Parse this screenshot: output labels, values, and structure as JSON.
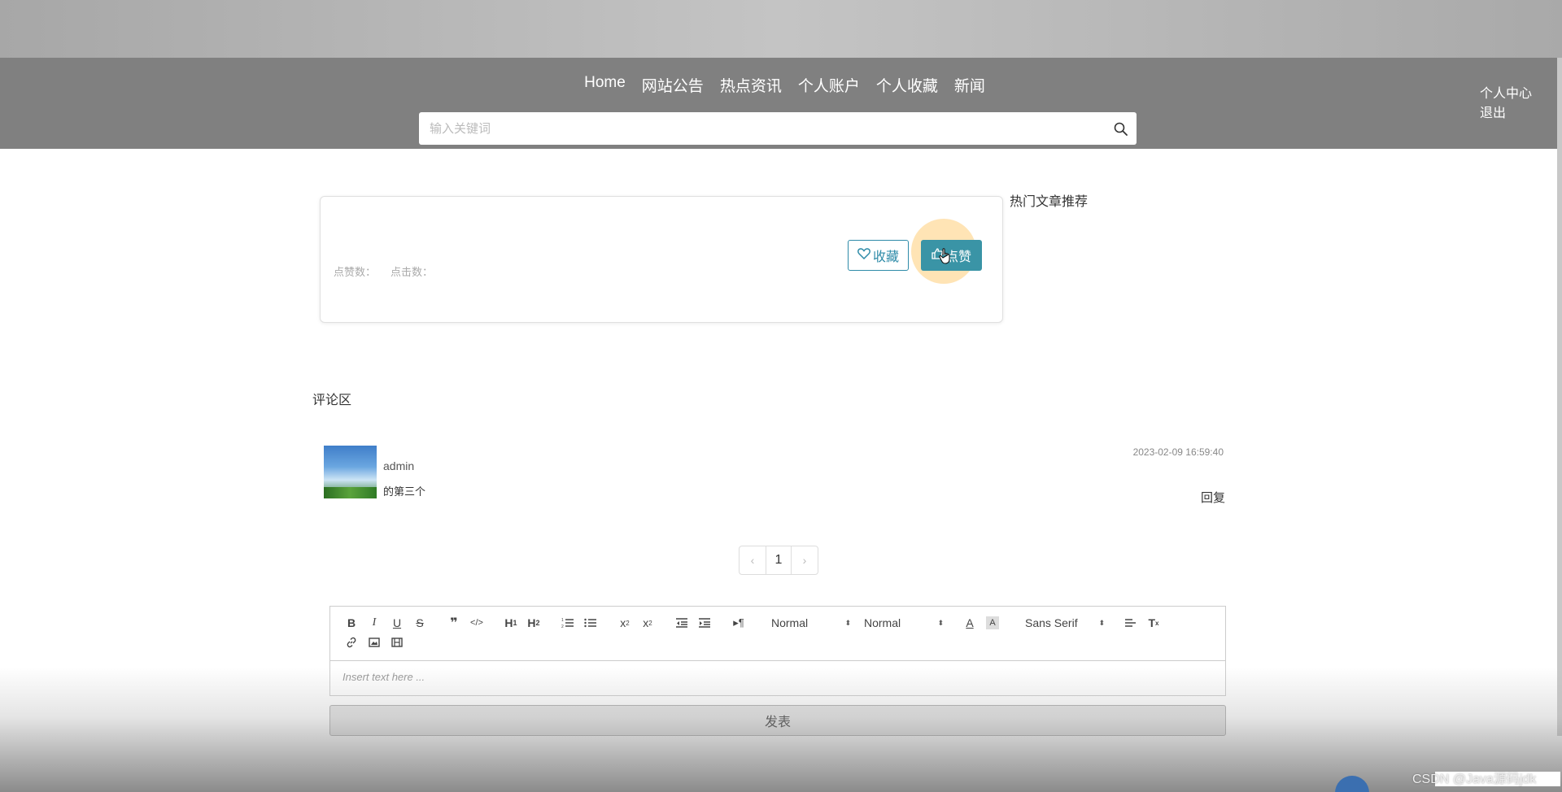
{
  "nav": {
    "items": [
      "Home",
      "网站公告",
      "热点资讯",
      "个人账户",
      "个人收藏",
      "新闻"
    ]
  },
  "search": {
    "placeholder": "输入关键词",
    "value": ""
  },
  "user_menu": {
    "center": "个人中心",
    "logout": "退出"
  },
  "article": {
    "likes_label": "点赞数：",
    "clicks_label": "点击数：",
    "collect_label": "收藏",
    "like_label": "点赞"
  },
  "hot_articles": {
    "title": "热门文章推荐"
  },
  "comments": {
    "title": "评论区",
    "items": [
      {
        "user": "admin",
        "content": "的第三个",
        "time": "2023-02-09 16:59:40",
        "reply_label": "回复"
      }
    ]
  },
  "pagination": {
    "prev": "‹",
    "current": "1",
    "next": "›"
  },
  "editor": {
    "header_select": "Normal",
    "size_select": "Normal",
    "font_select": "Sans Serif",
    "placeholder": "Insert text here ...",
    "submit_label": "发表"
  },
  "watermark": "CSDN @Java源码jdk",
  "colors": {
    "navbar": "#808080",
    "accent": "#3a94a6",
    "outline": "#2e8ba8"
  }
}
